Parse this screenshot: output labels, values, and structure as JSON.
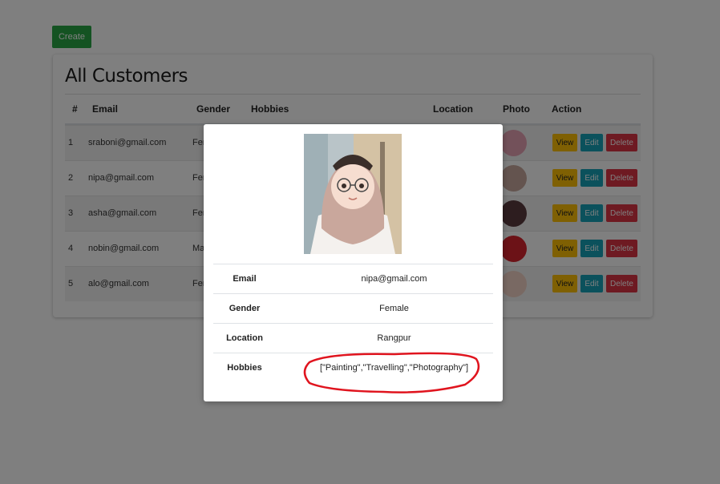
{
  "create_label": "Create",
  "card": {
    "title": "All Customers",
    "columns": [
      "#",
      "Email",
      "Gender",
      "Hobbies",
      "Location",
      "Photo",
      "Action"
    ],
    "rows": [
      {
        "num": "1",
        "email": "sraboni@gmail.com",
        "gender": "Fen"
      },
      {
        "num": "2",
        "email": "nipa@gmail.com",
        "gender": "Fen"
      },
      {
        "num": "3",
        "email": "asha@gmail.com",
        "gender": "Fen"
      },
      {
        "num": "4",
        "email": "nobin@gmail.com",
        "gender": "Ma"
      },
      {
        "num": "5",
        "email": "alo@gmail.com",
        "gender": "Fen"
      }
    ],
    "actions": {
      "view": "View",
      "edit": "Edit",
      "delete": "Delete"
    }
  },
  "modal": {
    "email_label": "Email",
    "email_value": "nipa@gmail.com",
    "gender_label": "Gender",
    "gender_value": "Female",
    "location_label": "Location",
    "location_value": "Rangpur",
    "hobbies_label": "Hobbies",
    "hobbies_value": "[\"Painting\",\"Travelling\",\"Photography\"]"
  },
  "colors": {
    "create": "#28a745",
    "view": "#ffc107",
    "edit": "#17a2b8",
    "delete": "#dc3545",
    "annotation": "#e0141e"
  }
}
